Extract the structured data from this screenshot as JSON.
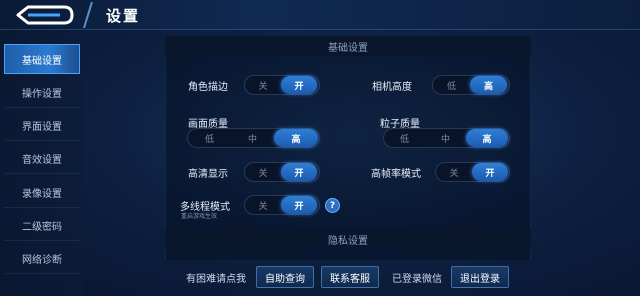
{
  "header": {
    "back_icon": "back-arrow-icon",
    "title": "设置"
  },
  "sidebar": {
    "items": [
      {
        "label": "基础设置",
        "active": true
      },
      {
        "label": "操作设置",
        "active": false
      },
      {
        "label": "界面设置",
        "active": false
      },
      {
        "label": "音效设置",
        "active": false
      },
      {
        "label": "录像设置",
        "active": false
      },
      {
        "label": "二级密码",
        "active": false
      },
      {
        "label": "网络诊断",
        "active": false
      }
    ]
  },
  "sections": {
    "basic": "基础设置",
    "privacy": "隐私设置"
  },
  "settings": {
    "outline": {
      "label": "角色描边",
      "options": [
        "关",
        "开"
      ],
      "selected": "开"
    },
    "camera_height": {
      "label": "相机高度",
      "options": [
        "低",
        "高"
      ],
      "selected": "高"
    },
    "graphics_quality": {
      "label": "画面质量",
      "options": [
        "低",
        "中",
        "高"
      ],
      "selected": "高"
    },
    "particle_quality": {
      "label": "粒子质量",
      "options": [
        "低",
        "中",
        "高"
      ],
      "selected": "高"
    },
    "hd_display": {
      "label": "高清显示",
      "options": [
        "关",
        "开"
      ],
      "selected": "开"
    },
    "high_fps": {
      "label": "高帧率模式",
      "options": [
        "关",
        "开"
      ],
      "selected": "开"
    },
    "multithread": {
      "label": "多线程模式",
      "note": "重启游戏生效",
      "options": [
        "关",
        "开"
      ],
      "selected": "开",
      "help": "?"
    }
  },
  "footer": {
    "help_text": "有困难请点我",
    "self_service_btn": "自助查询",
    "contact_btn": "联系客服",
    "login_status": "已登录微信",
    "logout_btn": "退出登录"
  },
  "colors": {
    "accent": "#2f7fd8",
    "background": "#0e2142",
    "active_tab": "#2c7ad0"
  }
}
